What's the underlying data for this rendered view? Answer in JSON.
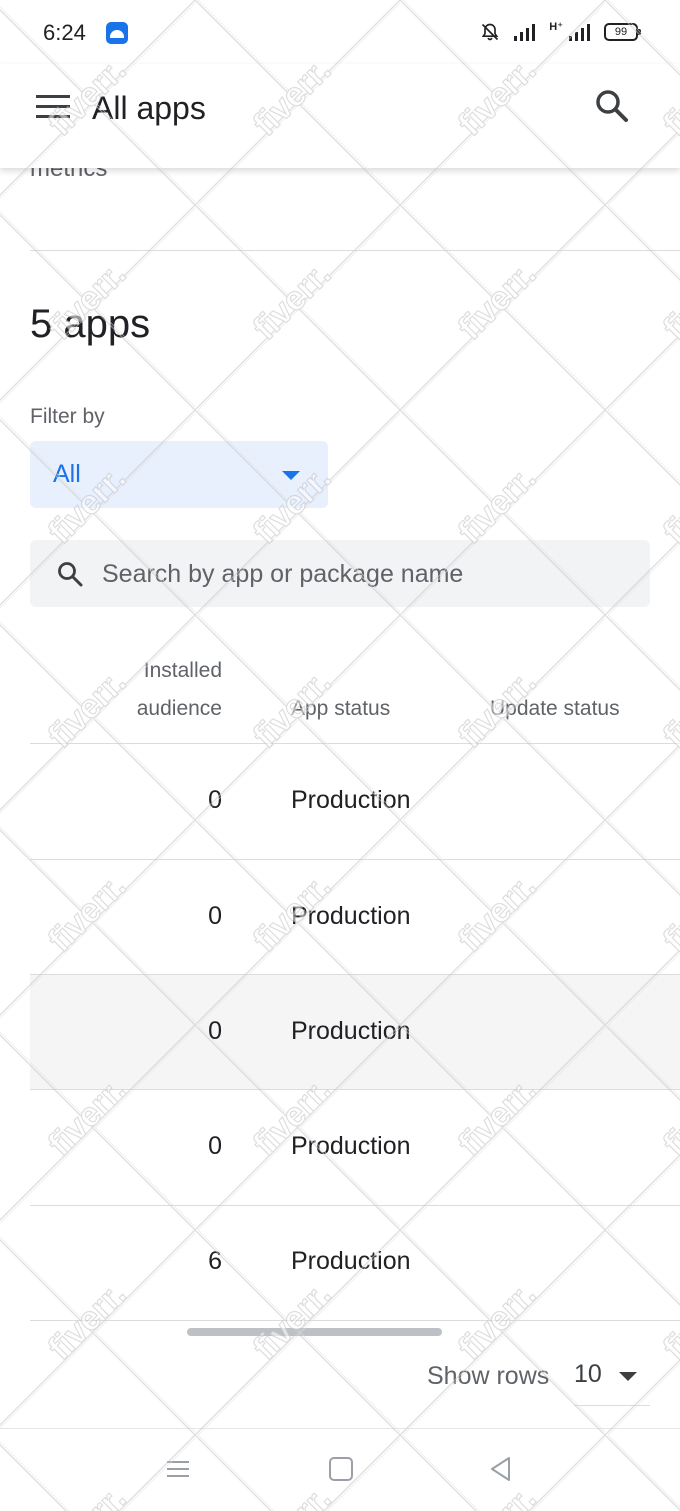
{
  "status_bar": {
    "time": "6:24",
    "battery": "99"
  },
  "app_bar": {
    "title": "All apps",
    "menu_icon": "hamburger-menu-icon",
    "search_icon": "search-icon"
  },
  "section_above": {
    "label": "metrics"
  },
  "apps": {
    "count_title": "5 apps",
    "filter": {
      "label": "Filter by",
      "selected": "All"
    },
    "search": {
      "placeholder": "Search by app or package name"
    },
    "table": {
      "columns": {
        "installed_audience_line1": "Installed",
        "installed_audience_line2": "audience",
        "app_status": "App status",
        "update_status": "Update status"
      },
      "rows": [
        {
          "installed_audience": "0",
          "app_status": "Production"
        },
        {
          "installed_audience": "0",
          "app_status": "Production"
        },
        {
          "installed_audience": "0",
          "app_status": "Production"
        },
        {
          "installed_audience": "0",
          "app_status": "Production"
        },
        {
          "installed_audience": "6",
          "app_status": "Production"
        }
      ]
    },
    "pagination": {
      "show_rows_label": "Show rows",
      "rows_value": "10"
    }
  },
  "watermark": {
    "text": "fiverr."
  },
  "colors": {
    "accent": "#1a73e8",
    "filter_bg": "#e8f0fe",
    "search_bg": "#f1f3f4"
  }
}
